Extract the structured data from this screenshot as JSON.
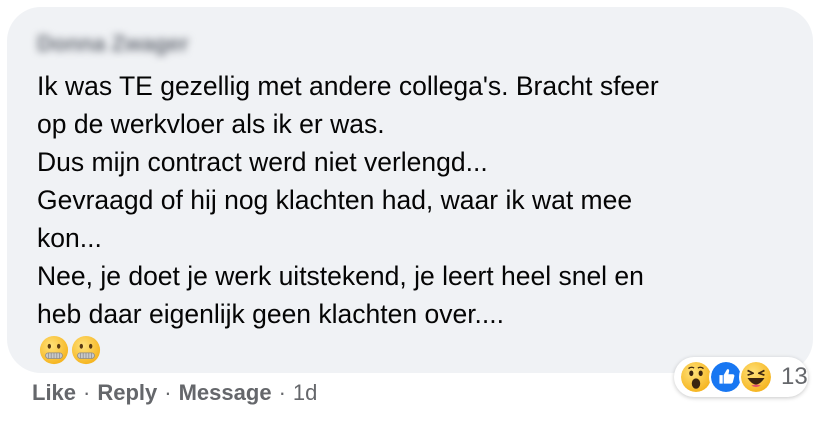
{
  "comment": {
    "author": "Donna Zwager",
    "lines": [
      "Ik was TE gezellig met andere collega's. Bracht sfeer",
      "op de werkvloer als ik er was.",
      "Dus mijn contract werd niet verlengd...",
      "Gevraagd of hij nog klachten had, waar ik wat mee",
      "kon...",
      "Nee, je doet je werk uitstekend, je leert heel snel en",
      "heb daar eigenlijk geen klachten over...."
    ],
    "emojis": [
      "zipper-mouth-face-icon",
      "zipper-mouth-face-icon"
    ]
  },
  "reactions": {
    "icons": [
      "wow-icon",
      "like-icon",
      "haha-icon"
    ],
    "count": "13"
  },
  "actions": {
    "like": "Like",
    "reply": "Reply",
    "message": "Message",
    "separator": "·",
    "time": "1d"
  },
  "colors": {
    "bubble_bg": "#f0f2f5",
    "text": "#050505",
    "secondary_text": "#65676b",
    "like_blue": "#1877f2",
    "reaction_yellow": "#fcd34d"
  }
}
